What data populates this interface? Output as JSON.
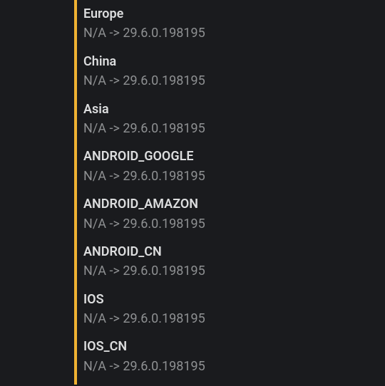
{
  "entries": [
    {
      "label": "Europe",
      "value": "N/A -> 29.6.0.198195"
    },
    {
      "label": "China",
      "value": "N/A -> 29.6.0.198195"
    },
    {
      "label": "Asia",
      "value": "N/A -> 29.6.0.198195"
    },
    {
      "label": "ANDROID_GOOGLE",
      "value": "N/A -> 29.6.0.198195"
    },
    {
      "label": "ANDROID_AMAZON",
      "value": "N/A -> 29.6.0.198195"
    },
    {
      "label": "ANDROID_CN",
      "value": "N/A -> 29.6.0.198195"
    },
    {
      "label": "IOS",
      "value": "N/A -> 29.6.0.198195"
    },
    {
      "label": "IOS_CN",
      "value": "N/A -> 29.6.0.198195"
    }
  ]
}
